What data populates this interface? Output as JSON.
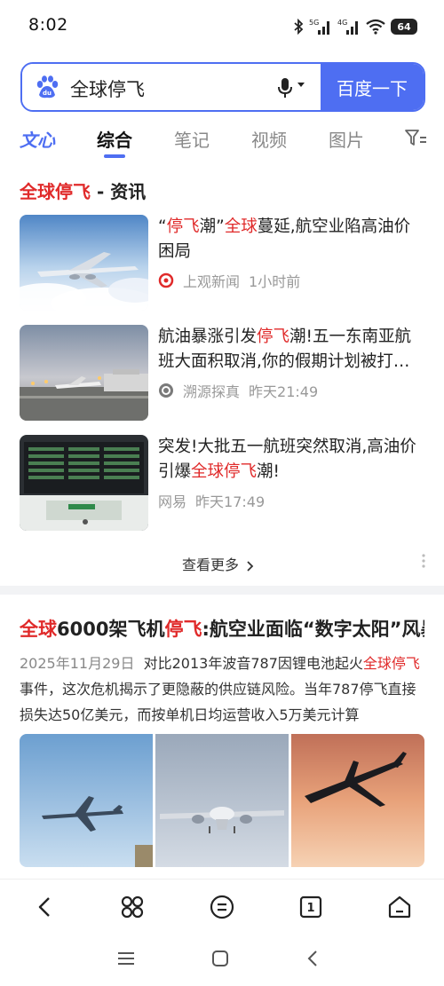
{
  "status_bar": {
    "time": "8:02",
    "signal_1_label": "5G",
    "signal_2_label": "4G",
    "battery": "64"
  },
  "search": {
    "query": "全球停飞",
    "button_label": "百度一下",
    "accent_color": "#4e6ef2"
  },
  "tabs": [
    {
      "label": "文心",
      "icon": "wenxin-logo"
    },
    {
      "label": "综合",
      "active": true
    },
    {
      "label": "笔记"
    },
    {
      "label": "视频"
    },
    {
      "label": "图片"
    }
  ],
  "news_card": {
    "title_highlight": "全球停飞",
    "title_rest": " - 资讯",
    "items": [
      {
        "title_parts": [
          "“",
          "停飞",
          "潮”",
          "全球",
          "蔓延,航空业陷高油价困局"
        ],
        "source": "上观新闻",
        "time": "1小时前"
      },
      {
        "title_parts": [
          "航油暴涨引发",
          "停飞",
          "潮!五一东南亚航班大面积取消,你的假期计划被打乱了吗"
        ],
        "source": "溯源探真",
        "time": "昨天21:49"
      },
      {
        "title_parts": [
          "突发!大批五一航班突然取消,高油价引爆",
          "全球停飞",
          "潮!"
        ],
        "source": "网易",
        "time": "昨天17:49"
      }
    ],
    "more_label": "查看更多"
  },
  "article": {
    "title_parts": [
      "全球",
      "6000架飞机",
      "停飞",
      ":航空业面临“数字太阳”风暴"
    ],
    "date": "2025年11月29日",
    "snippet_parts": [
      "对比2013年波音787因锂电池起火",
      "全球停飞",
      "事件，这次危机揭示了更隐蔽的供应链风险。当年787停飞直接损失达50亿美元，而按单机日均运营收入5万美元计算"
    ]
  },
  "toolbar": {
    "back_icon": "chevron-left-icon",
    "apps_icon": "apps-icon",
    "menu_icon": "menu-icon",
    "tab_count": "1",
    "home_icon": "home-icon"
  },
  "colors": {
    "highlight": "#e02a2a",
    "accent": "#4e6ef2"
  }
}
